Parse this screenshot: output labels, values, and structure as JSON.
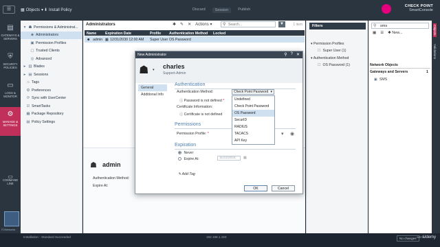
{
  "topbar": {
    "menu_label": "☰",
    "objects_label": "Objects",
    "install_policy_label": "Install Policy",
    "tabs": [
      "Discard",
      "Session",
      "Publish"
    ],
    "brand_line1": "CHECK POINT",
    "brand_line2": "SmartConsole"
  },
  "leftnav": {
    "items": [
      {
        "label": "GATEWAYS & SERVERS"
      },
      {
        "label": "SECURITY POLICIES"
      },
      {
        "label": "LOGS & MONITOR"
      },
      {
        "label": "MANAGE & SETTINGS"
      }
    ],
    "command_line": "COMMAND LINE",
    "watermark": "IT-Networks"
  },
  "tree": {
    "items": [
      {
        "label": "Permissions & Administrat..."
      },
      {
        "label": "Administrators"
      },
      {
        "label": "Permission Profiles"
      },
      {
        "label": "Trusted Clients"
      },
      {
        "label": "Advanced"
      },
      {
        "label": "Blades"
      },
      {
        "label": "Sessions"
      },
      {
        "label": "Tags"
      },
      {
        "label": "Preferences"
      },
      {
        "label": "Sync with UserCenter"
      },
      {
        "label": "SmartTasks"
      },
      {
        "label": "Package Repository"
      },
      {
        "label": "Policy Settings"
      }
    ]
  },
  "main": {
    "title": "Administrators",
    "actions_label": "Actions",
    "search_placeholder": "Search...",
    "items_count": "1 item",
    "columns": [
      "Name",
      "Expiration Date",
      "Profile",
      "Authentication Method",
      "Locked"
    ],
    "row": [
      "admin",
      "12/31/2030 12:00 AM",
      "Super User",
      "OS Password",
      ""
    ],
    "detail": {
      "name": "admin",
      "auth_label": "Authentication Method:",
      "expire_label": "Expire At:"
    }
  },
  "filters": {
    "title": "Filters",
    "sections": [
      {
        "title": "Permission Profiles",
        "item": "Super User (1)"
      },
      {
        "title": "Authentication Method",
        "item": "OS Password (1)"
      }
    ]
  },
  "objects": {
    "search_value": "sms",
    "new_label": "New...",
    "section": "Network Objects",
    "subsection": "Gateways and Servers",
    "sub_count": "1",
    "item": "SMS",
    "vertical_tabs": [
      "Objects",
      "Validations"
    ]
  },
  "dialog": {
    "title": "New Administrator",
    "name": "charles",
    "subtitle": "Support-Admin",
    "nav": [
      "General",
      "Additional Info"
    ],
    "authentication": {
      "title": "Authentication",
      "method_label": "Authentication Method:",
      "method_value": "Check Point Password",
      "password_status": "Password is not defined",
      "certificate_label": "Certificate Information:",
      "certificate_status": "Certificate is not defined",
      "options": [
        "Undefined",
        "Check Point Password",
        "OS Password",
        "SecurID",
        "RADIUS",
        "TACACS",
        "API Key"
      ],
      "hovered_option": "OS Password"
    },
    "permissions": {
      "title": "Permissions",
      "profile_label": "Permission Profile:"
    },
    "expiration": {
      "title": "Expiration",
      "never": "Never",
      "expire_at": "Expire At:",
      "date_placeholder": "11/22/2024"
    },
    "add_tag": "Add Tag",
    "ok": "OK",
    "cancel": "Cancel"
  },
  "statusbar": {
    "left": "Installation - Standard Succeeded",
    "ip": "192.168.1.150",
    "changes": "No changes",
    "user": "admin",
    "brand": "Udemy"
  }
}
